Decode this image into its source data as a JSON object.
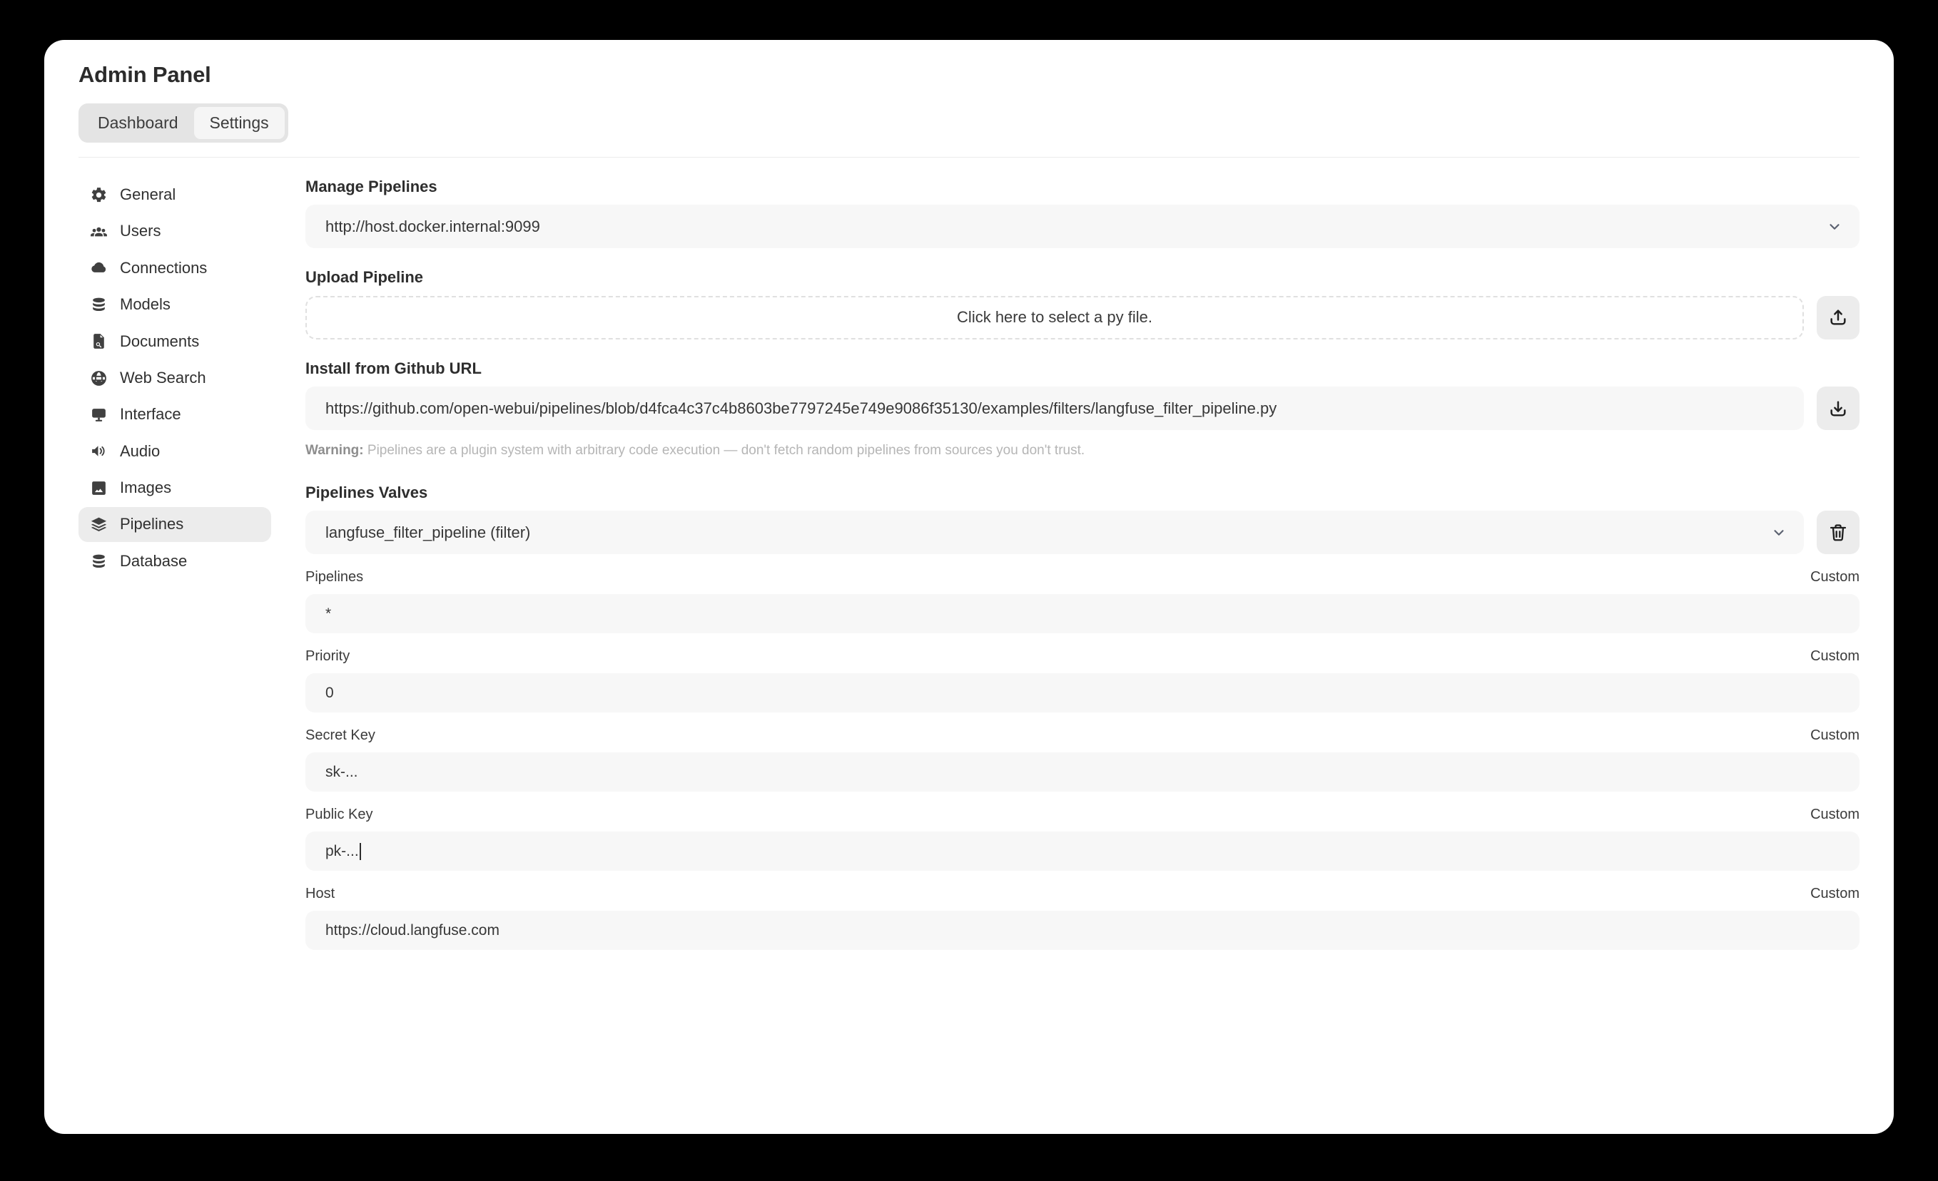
{
  "header": {
    "title": "Admin Panel",
    "tabs": [
      {
        "label": "Dashboard",
        "active": false
      },
      {
        "label": "Settings",
        "active": true
      }
    ]
  },
  "sidebar": {
    "items": [
      {
        "label": "General",
        "icon": "gear-icon",
        "active": false
      },
      {
        "label": "Users",
        "icon": "users-icon",
        "active": false
      },
      {
        "label": "Connections",
        "icon": "cloud-icon",
        "active": false
      },
      {
        "label": "Models",
        "icon": "stack-db-icon",
        "active": false
      },
      {
        "label": "Documents",
        "icon": "document-search-icon",
        "active": false
      },
      {
        "label": "Web Search",
        "icon": "globe-icon",
        "active": false
      },
      {
        "label": "Interface",
        "icon": "monitor-icon",
        "active": false
      },
      {
        "label": "Audio",
        "icon": "speaker-icon",
        "active": false
      },
      {
        "label": "Images",
        "icon": "image-icon",
        "active": false
      },
      {
        "label": "Pipelines",
        "icon": "layers-icon",
        "active": true
      },
      {
        "label": "Database",
        "icon": "database-icon",
        "active": false
      }
    ]
  },
  "main": {
    "manage_pipelines": {
      "label": "Manage Pipelines",
      "value": "http://host.docker.internal:9099",
      "chevron_icon": "chevron-down-icon"
    },
    "upload_pipeline": {
      "label": "Upload Pipeline",
      "dropzone_text": "Click here to select a py file.",
      "button_icon": "upload-icon"
    },
    "install_github": {
      "label": "Install from Github URL",
      "value": "https://github.com/open-webui/pipelines/blob/d4fca4c37c4b8603be7797245e749e9086f35130/examples/filters/langfuse_filter_pipeline.py",
      "button_icon": "download-icon",
      "warning_prefix": "Warning:",
      "warning_text": " Pipelines are a plugin system with arbitrary code execution — don't fetch random pipelines from sources you don't trust."
    },
    "pipelines_valves": {
      "label": "Pipelines Valves",
      "selected_pipeline": "langfuse_filter_pipeline (filter)",
      "chevron_icon": "chevron-down-icon",
      "delete_icon": "trash-icon",
      "custom_label": "Custom",
      "valves": [
        {
          "name": "Pipelines",
          "value": "*",
          "custom": "Custom",
          "focused": false
        },
        {
          "name": "Priority",
          "value": "0",
          "custom": "Custom",
          "focused": false
        },
        {
          "name": "Secret Key",
          "value": "sk-...",
          "custom": "Custom",
          "focused": false
        },
        {
          "name": "Public Key",
          "value": "pk-...",
          "custom": "Custom",
          "focused": true
        },
        {
          "name": "Host",
          "value": "https://cloud.langfuse.com",
          "custom": "Custom",
          "focused": false
        }
      ]
    }
  },
  "colors": {
    "backdrop": "#000000",
    "surface": "#ffffff",
    "field_bg": "#f7f7f7",
    "button_bg": "#ececec",
    "active_nav_bg": "#ececec",
    "text_primary": "#2e2e2e",
    "text_muted": "#b5b5b5"
  }
}
